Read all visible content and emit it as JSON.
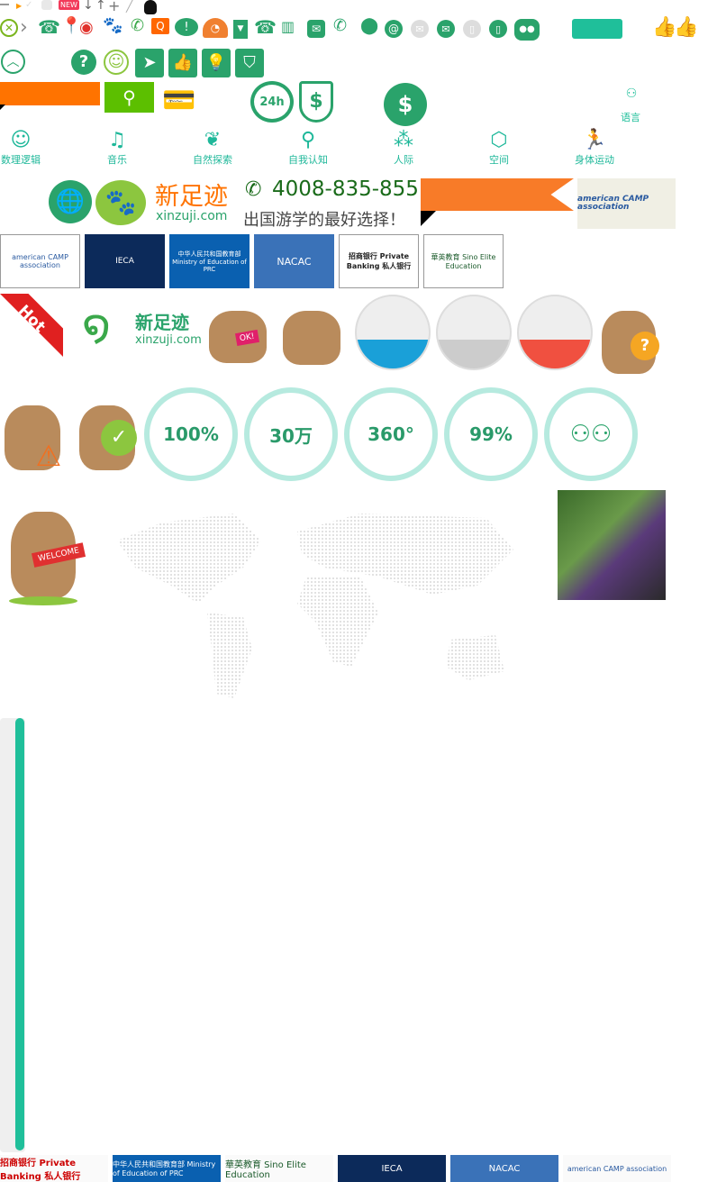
{
  "top_row": {
    "new_badge": "NEW"
  },
  "search": {
    "button_icon": "search-icon"
  },
  "language": {
    "label": "语言"
  },
  "categories": [
    {
      "label": "数理逻辑",
      "icon": "head-gear-icon"
    },
    {
      "label": "音乐",
      "icon": "music-note-icon"
    },
    {
      "label": "自然探索",
      "icon": "leaf-icon"
    },
    {
      "label": "自我认知",
      "icon": "self-search-icon"
    },
    {
      "label": "人际",
      "icon": "people-network-icon"
    },
    {
      "label": "空间",
      "icon": "cube-icon"
    },
    {
      "label": "身体运动",
      "icon": "runner-icon"
    }
  ],
  "brand": {
    "name": "新足迹",
    "domain": "xinzuji.com",
    "phone": "4008-835-855",
    "slogan": "出国游学的最好选择！"
  },
  "partners": [
    "american CAMP association",
    "IECA",
    "中华人民共和国教育部 Ministry of Education of PRC",
    "NACAC",
    "招商银行 Private Banking 私人银行",
    "華英教育 Sino Elite Education"
  ],
  "hot_label": "Hot",
  "moose_ok": "OK!",
  "stats": [
    "100%",
    "30万",
    "360°",
    "99%",
    ""
  ],
  "welcome": "WELCOME",
  "colors": {
    "green": "#2aa36b",
    "teal": "#1fbf9a",
    "orange": "#ff7300",
    "lime": "#5cbf00"
  }
}
